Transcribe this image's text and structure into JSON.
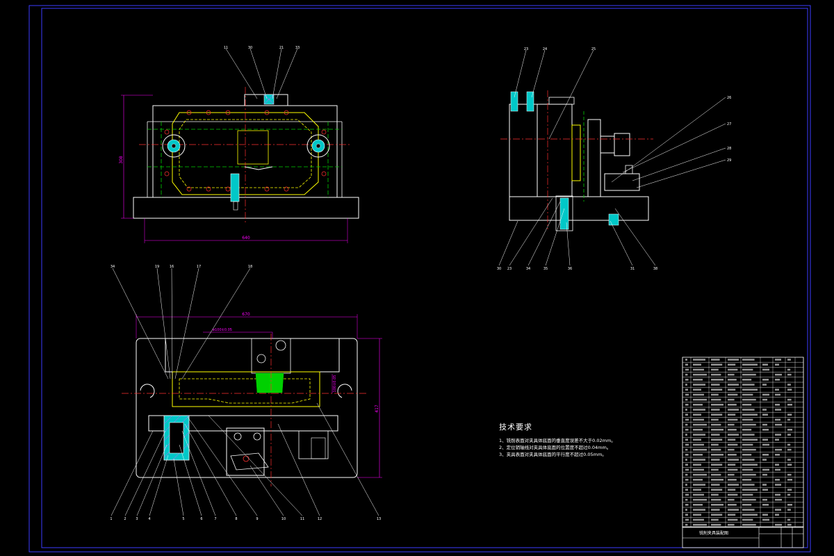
{
  "palette": {
    "background": "#000000",
    "outline": "#ffffff",
    "frame": "#3b3bff",
    "center_line": "#ff3030",
    "hidden_line": "#00d000",
    "part_line": "#ffff00",
    "dimension": "#ff00ff",
    "section_fill": "#00c8c8",
    "section_hatch": "#ff40ff",
    "leader": "#ffffff"
  },
  "dimensions": {
    "front_height": "308",
    "front_width": "640",
    "top_width": "670",
    "top_height": "417",
    "top_small_a": "ø100±0.05",
    "top_small_b": "100±0.05"
  },
  "technical_requirements": {
    "title": "技术要求",
    "items": [
      "1、铣削表面对夹具体底面的垂直度误差不大于0.02mm。",
      "2、定位销轴线对夹具体底面的位置度不超过0.04mm。",
      "3、夹具表面对夹具体底面的平行度不超过0.05mm。"
    ]
  },
  "title_block": {
    "drawing_name": "铣削夹具装配图"
  },
  "front_view_labels": [
    "11",
    "30",
    "21",
    "33"
  ],
  "side_view_labels_top": [
    "23",
    "24",
    "25"
  ],
  "side_view_labels_right": [
    "26",
    "27",
    "28",
    "29"
  ],
  "side_view_labels_bottom": [
    "30",
    "23",
    "34",
    "35",
    "36",
    "31",
    "38"
  ],
  "top_view_labels_top": [
    "34",
    "19",
    "16",
    "17",
    "18"
  ],
  "top_view_labels_bottom": [
    "1",
    "2",
    "3",
    "4",
    "5",
    "6",
    "7",
    "8",
    "9",
    "10",
    "11",
    "12",
    "13"
  ]
}
